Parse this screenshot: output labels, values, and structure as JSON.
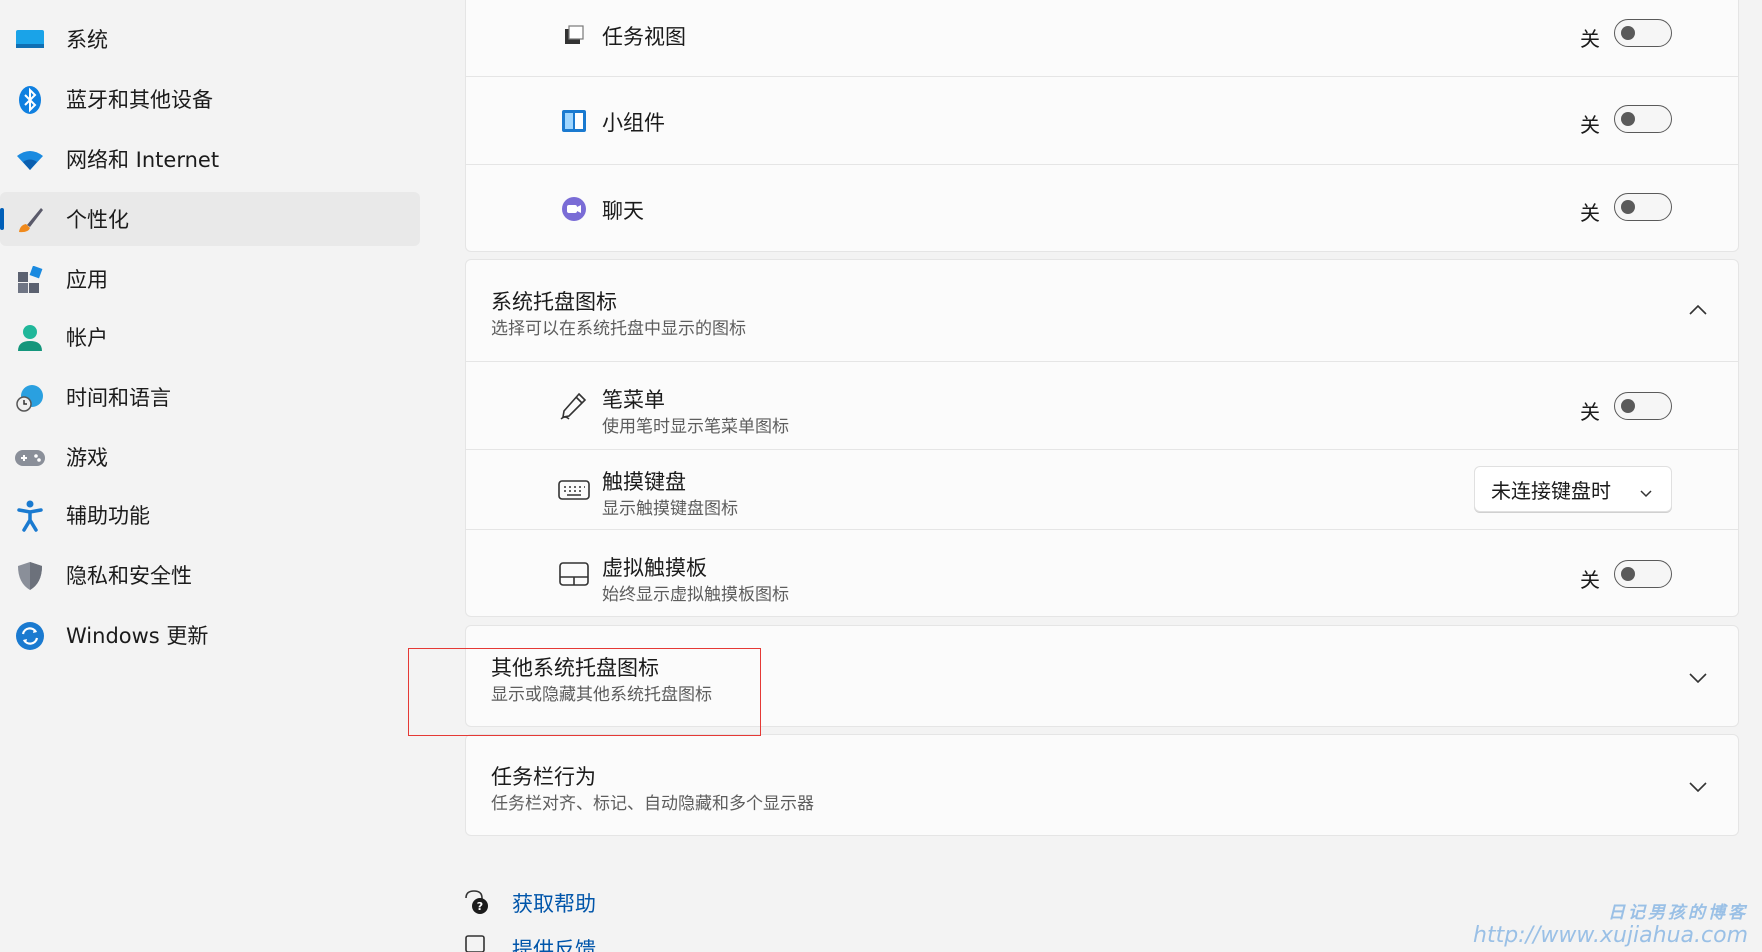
{
  "sidebar": {
    "items": [
      {
        "label": "系统",
        "icon": "monitor-icon"
      },
      {
        "label": "蓝牙和其他设备",
        "icon": "bluetooth-icon"
      },
      {
        "label": "网络和 Internet",
        "icon": "wifi-icon"
      },
      {
        "label": "个性化",
        "icon": "paintbrush-icon",
        "active": true
      },
      {
        "label": "应用",
        "icon": "apps-icon"
      },
      {
        "label": "帐户",
        "icon": "person-icon"
      },
      {
        "label": "时间和语言",
        "icon": "globe-clock-icon"
      },
      {
        "label": "游戏",
        "icon": "gamepad-icon"
      },
      {
        "label": "辅助功能",
        "icon": "accessibility-icon"
      },
      {
        "label": "隐私和安全性",
        "icon": "shield-icon"
      },
      {
        "label": "Windows 更新",
        "icon": "update-icon"
      }
    ]
  },
  "taskbar_items": {
    "rows": [
      {
        "label": "任务视图",
        "state": "关",
        "icon": "task-view-icon"
      },
      {
        "label": "小组件",
        "state": "关",
        "icon": "widgets-icon"
      },
      {
        "label": "聊天",
        "state": "关",
        "icon": "chat-icon"
      }
    ]
  },
  "tray_icons": {
    "title": "系统托盘图标",
    "subtitle": "选择可以在系统托盘中显示的图标",
    "rows": [
      {
        "label": "笔菜单",
        "sub": "使用笔时显示笔菜单图标",
        "state": "关",
        "icon": "pen-icon"
      },
      {
        "label": "触摸键盘",
        "sub": "显示触摸键盘图标",
        "dropdown": "未连接键盘时",
        "icon": "keyboard-icon"
      },
      {
        "label": "虚拟触摸板",
        "sub": "始终显示虚拟触摸板图标",
        "state": "关",
        "icon": "touchpad-icon"
      }
    ]
  },
  "other_tray": {
    "title": "其他系统托盘图标",
    "subtitle": "显示或隐藏其他系统托盘图标"
  },
  "behaviors": {
    "title": "任务栏行为",
    "subtitle": "任务栏对齐、标记、自动隐藏和多个显示器"
  },
  "footer": {
    "help": "获取帮助",
    "feedback": "提供反馈"
  },
  "watermark": {
    "line1": "日记男孩的博客",
    "line2": "http://www.xujiahua.com"
  },
  "colors": {
    "accent": "#005fb8",
    "highlight_box": "#e53935"
  }
}
